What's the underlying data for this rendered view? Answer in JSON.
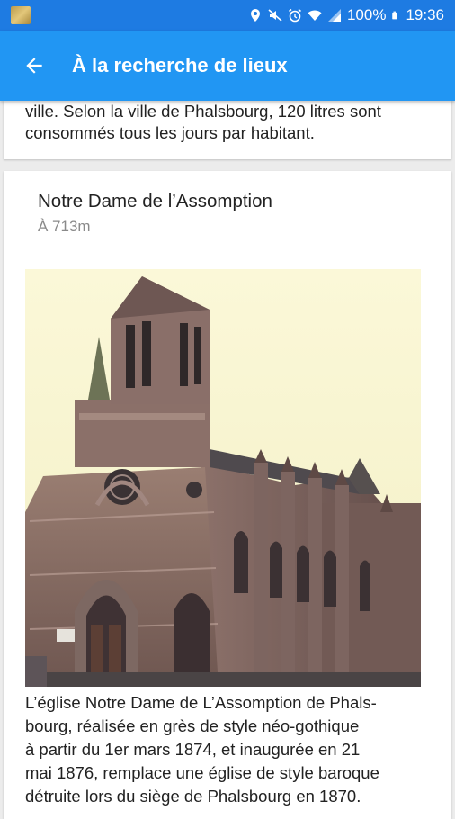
{
  "status_bar": {
    "battery_percent": "100%",
    "time": "19:36",
    "icons": [
      "location-icon",
      "mute-icon",
      "alarm-icon",
      "wifi-icon",
      "signal-icon",
      "battery-icon"
    ]
  },
  "app_bar": {
    "back_icon": "arrow-left-icon",
    "title": "À la recherche de lieux"
  },
  "previous_card": {
    "text_line_1": "ville. Selon la ville de Phalsbourg, 120 litres sont",
    "text_line_2": "consommés tous les jours par habitant."
  },
  "place_card": {
    "title": "Notre Dame de l’Assomption",
    "distance": "À 713m",
    "description_lines": [
      "L’église Notre Dame de L’Assomption de Phals-",
      "bourg, réalisée en grès de style néo-gothique",
      "à partir du 1er mars 1874, et inaugurée en 21",
      "mai 1876, remplace une église de style baroque",
      "détruite lors du siège de Phalsbourg en 1870."
    ]
  },
  "colors": {
    "status_bar": "#1e7be2",
    "app_bar": "#2196f3",
    "background": "#ececec",
    "card": "#ffffff"
  }
}
